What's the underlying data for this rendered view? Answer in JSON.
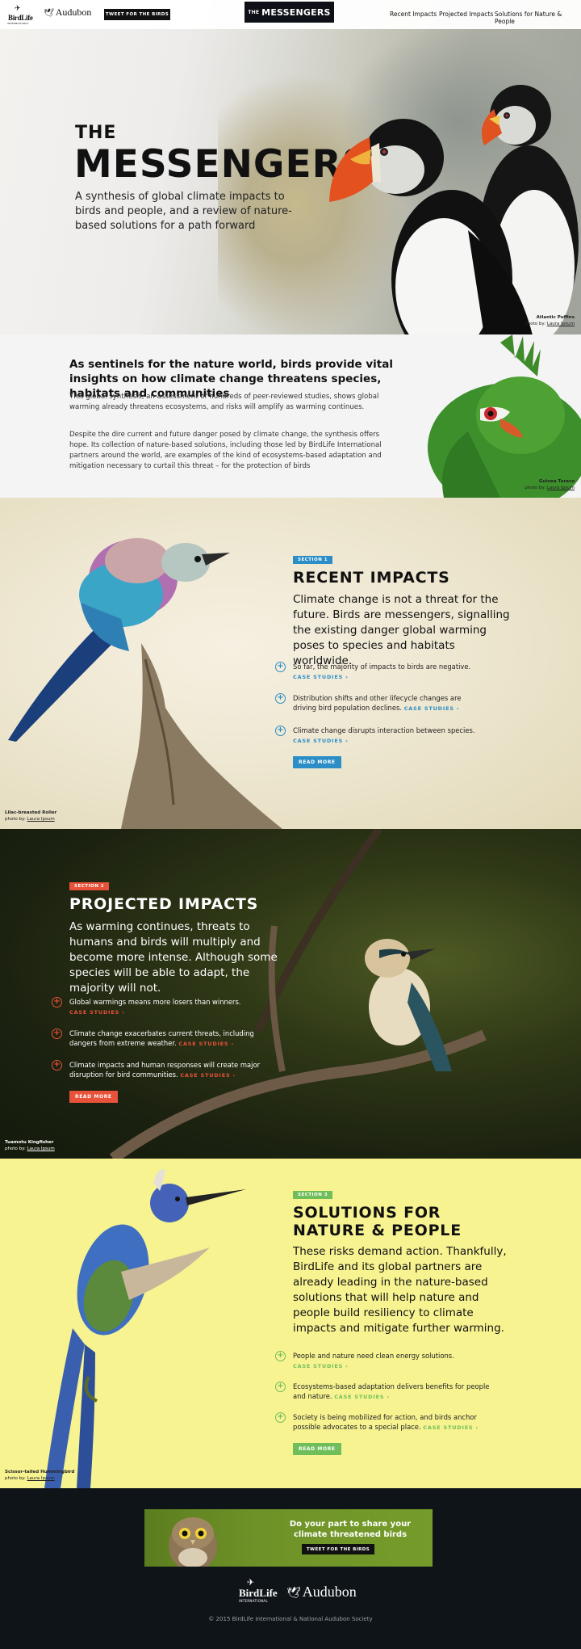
{
  "header": {
    "birdlife_logo": "BirdLife",
    "birdlife_sub": "INTERNATIONAL",
    "audubon_logo": "Audubon",
    "tweet_button": "TWEET FOR THE BIRDS",
    "brand_the": "THE",
    "brand_name": "MESSENGERS",
    "nav": [
      "Recent Impacts",
      "Projected Impacts",
      "Solutions for Nature & People"
    ]
  },
  "hero": {
    "title_small": "THE",
    "title_big": "MESSENGERS",
    "description": "A synthesis of global climate impacts to birds and people, and a review of nature-based solutions for a path forward",
    "caption_title": "Atlantic Puffins",
    "caption_photo_prefix": "photo by:",
    "caption_photographer": "Laura Ipsum"
  },
  "intro": {
    "heading": "As sentinels for the nature world, birds provide vital insights on how climate change threatens species, habitats and communities",
    "paragraph1": "This global synthesis, an assessment of hundreds of peer-reviewed studies, shows global warming already threatens ecosystems, and risks will amplify as warming continues.",
    "paragraph2": "Despite the dire current and future danger posed by climate change, the synthesis offers hope. Its collection of nature-based solutions, including those led by BirdLife International partners around the world, are examples of the kind of ecosystems-based adaptation and mitigation necessary to curtail this threat – for the protection of birds",
    "caption_title": "Guinea Turaco",
    "caption_photo_prefix": "photo by:",
    "caption_photographer": "Laura Ipsum"
  },
  "recent": {
    "tag": "SECTION 1",
    "title": "RECENT IMPACTS",
    "lead": "Climate change is not a threat for the future. Birds are messengers, signalling the existing danger global warming poses to species and habitats worldwide.",
    "bullets": [
      {
        "text": "So far, the majority of impacts to birds are negative.",
        "link": "CASE STUDIES"
      },
      {
        "text": "Distribution shifts and other lifecycle changes are driving bird population declines.",
        "link": "CASE STUDIES"
      },
      {
        "text": "Climate change disrupts interaction between species.",
        "link": "CASE STUDIES"
      }
    ],
    "read_more": "READ MORE",
    "caption_title": "Lilac-breasted Roller",
    "caption_photo_prefix": "photo by:",
    "caption_photographer": "Laura Ipsum",
    "accent": "#2b8ec6"
  },
  "projected": {
    "tag": "SECTION 2",
    "title": "PROJECTED IMPACTS",
    "lead": "As warming continues, threats to humans and birds will multiply and become more intense. Although some species will be able to adapt, the majority will not.",
    "bullets": [
      {
        "text": "Global warmings means more losers than winners.",
        "link": "CASE STUDIES"
      },
      {
        "text": "Climate change exacerbates current threats, including dangers from extreme weather.",
        "link": "CASE STUDIES"
      },
      {
        "text": "Climate impacts and human responses will create major disruption for bird communities.",
        "link": "CASE STUDIES"
      }
    ],
    "read_more": "READ MORE",
    "caption_title": "Tuamotu Kingfisher",
    "caption_photo_prefix": "photo by:",
    "caption_photographer": "Laura Ipsum",
    "accent": "#e8513a"
  },
  "solutions": {
    "tag": "SECTION 3",
    "title_line1": "SOLUTIONS FOR",
    "title_line2": "NATURE & PEOPLE",
    "lead": "These risks demand action. Thankfully, BirdLife and its global partners are already leading in the nature-based solutions that will help nature and people build resiliency to climate impacts and mitigate further warming.",
    "bullets": [
      {
        "text": "People and nature need clean energy solutions.",
        "link": "CASE STUDIES"
      },
      {
        "text": "Ecosystems-based adaptation delivers benefits for people and nature.",
        "link": "CASE STUDIES"
      },
      {
        "text": "Society is being mobilized for action, and birds anchor possible advocates to a special place.",
        "link": "CASE STUDIES"
      }
    ],
    "read_more": "READ MORE",
    "caption_title": "Scissor-tailed Hummingbird",
    "caption_photo_prefix": "photo by:",
    "caption_photographer": "Laura Ipsum",
    "accent": "#6fbe5a"
  },
  "footer": {
    "promo_text": "Do your part to share your climate threatened birds",
    "promo_button": "TWEET FOR THE BIRDS",
    "birdlife_logo": "BirdLife",
    "birdlife_sub": "INTERNATIONAL",
    "audubon_logo": "Audubon",
    "copyright": "© 2015 BirdLife International & National Audubon Society"
  }
}
